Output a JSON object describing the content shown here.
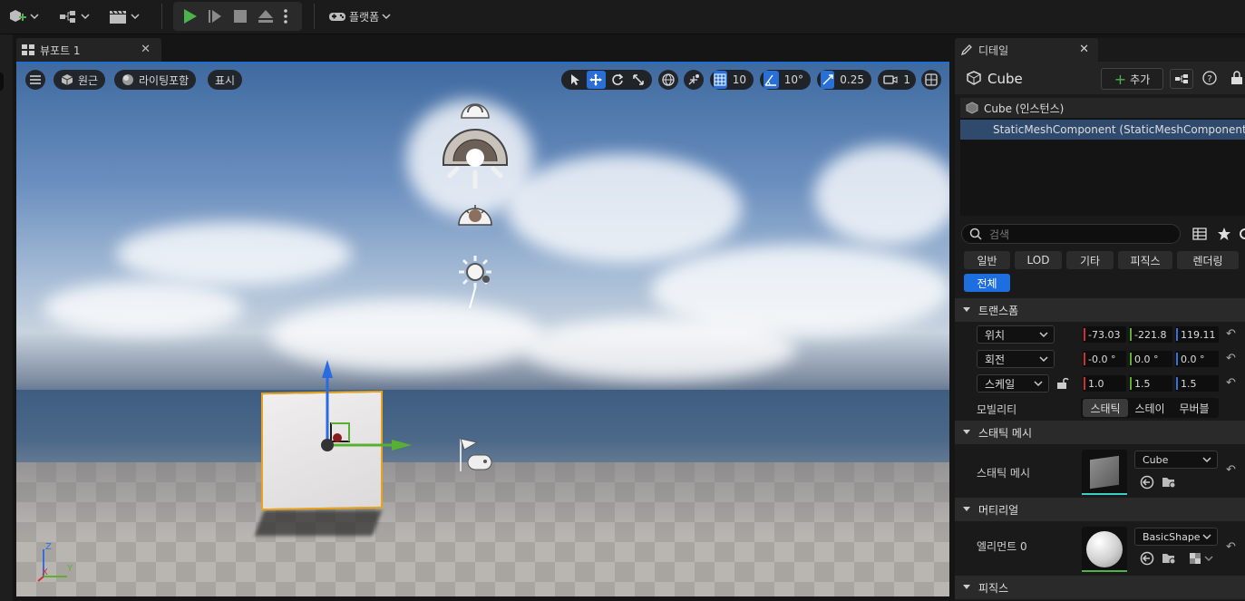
{
  "toolbar": {
    "platform_label": "플랫폼"
  },
  "viewport": {
    "tab_label": "뷰포트 1",
    "perspective_label": "원근",
    "lighting_label": "라이팅포함",
    "show_label": "표시",
    "grid_snap_value": "10",
    "rotation_snap_value": "10°",
    "scale_snap_value": "0.25",
    "camera_speed_value": "1",
    "axis_z": "Z",
    "axis_x": "X",
    "axis_y": "Y"
  },
  "details": {
    "tab_label": "디테일",
    "actor_name": "Cube",
    "add_label": "추가",
    "tree": [
      {
        "label": "Cube (인스턴스)"
      },
      {
        "label": "StaticMeshComponent (StaticMeshComponent)"
      }
    ],
    "search_placeholder": "검색",
    "categories": [
      "일반",
      "LOD",
      "기타",
      "피직스",
      "렌더링",
      "전체"
    ],
    "transform": {
      "section_label": "트랜스폼",
      "location_label": "위치",
      "location": [
        "-73.03",
        "-221.8",
        "119.11"
      ],
      "rotation_label": "회전",
      "rotation": [
        "-0.0 °",
        "0.0 °",
        "0.0 °"
      ],
      "scale_label": "스케일",
      "scale": [
        "1.0",
        "1.5",
        "1.5"
      ],
      "mobility_label": "모빌리티",
      "mobility_options": [
        "스태틱",
        "스테이",
        "무버블"
      ]
    },
    "static_mesh": {
      "section_label": "스태틱 메시",
      "row_label": "스태틱 메시",
      "value": "Cube"
    },
    "materials": {
      "section_label": "머티리얼",
      "row_label": "엘리먼트 0",
      "value": "BasicShape"
    },
    "physics": {
      "section_label": "피직스"
    }
  },
  "colors": {
    "accent": "#1d6ee0",
    "selection": "#e8a21b",
    "axis_x": "#d03030",
    "axis_y": "#60b030",
    "axis_z": "#3070e0"
  }
}
